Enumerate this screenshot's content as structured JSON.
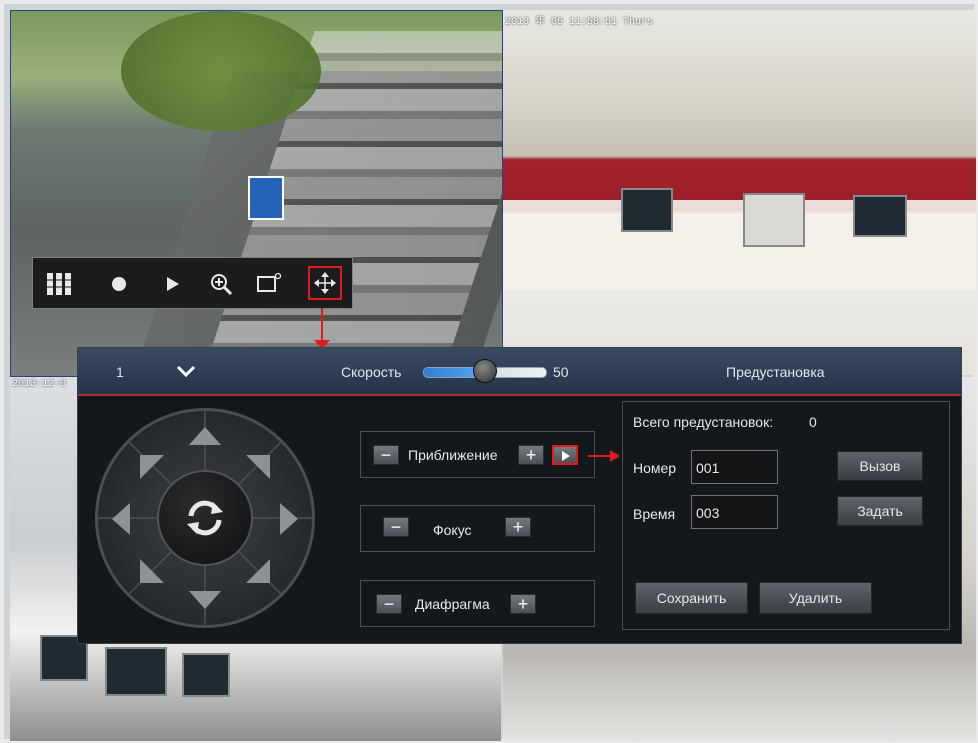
{
  "osd": {
    "cam2_timestamp": "2013 年 05 11:58:51 Thurs",
    "cam3_timestamp": "2013-12-0"
  },
  "toolbar": {
    "items": [
      {
        "name": "layout-icon",
        "glyph": "▮▮▮"
      },
      {
        "name": "record-icon",
        "glyph": "●"
      },
      {
        "name": "play-icon",
        "glyph": "▶"
      },
      {
        "name": "zoom-in-icon",
        "glyph": "⊕"
      },
      {
        "name": "color-settings-icon",
        "glyph": "▭"
      },
      {
        "name": "ptz-move-icon",
        "glyph": "✥"
      }
    ]
  },
  "ptz": {
    "channel": "1",
    "speed_label": "Скорость",
    "speed_value": "50",
    "speed_fraction": 0.5,
    "preset_tab": "Предустановка",
    "zoom_label": "Приближение",
    "focus_label": "Фокус",
    "iris_label": "Диафрагма",
    "minus": "−",
    "plus": "+"
  },
  "preset": {
    "total_label": "Всего предустановок:",
    "total_value": "0",
    "number_label": "Номер",
    "number_value": "001",
    "time_label": "Время",
    "time_value": "003",
    "call_button": "Вызов",
    "set_button": "Задать",
    "save_button": "Сохранить",
    "delete_button": "Удалить"
  },
  "colors": {
    "accent_red": "#e21a1a",
    "header_blue": "#2e4662",
    "speed_blue": "#2e7fd6"
  }
}
